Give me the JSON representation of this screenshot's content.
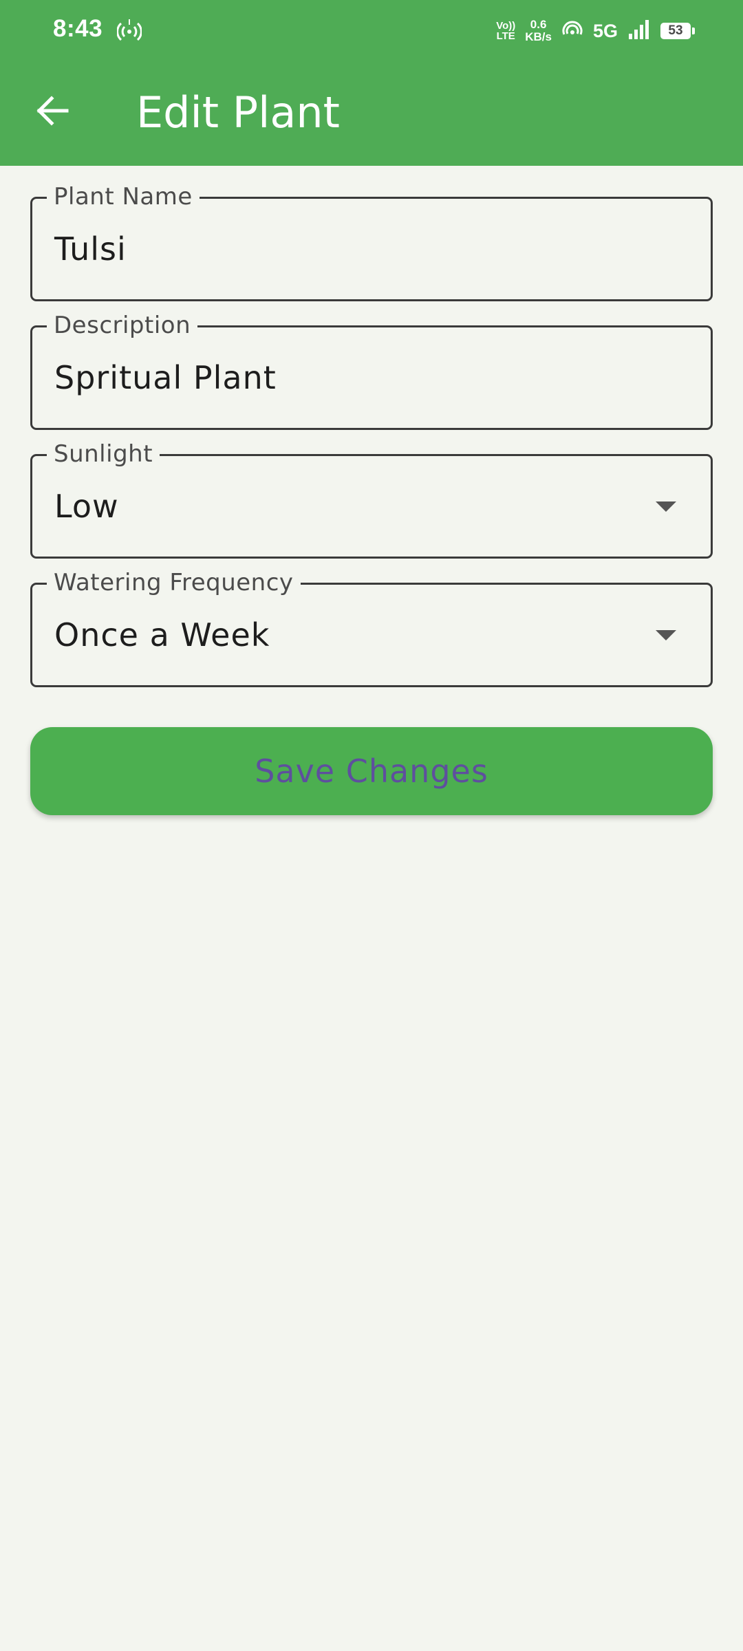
{
  "status_bar": {
    "time": "8:43",
    "volte_top": "Vo))",
    "volte_bottom": "LTE",
    "speed_value": "0.6",
    "speed_unit": "KB/s",
    "network": "5G",
    "battery": "53"
  },
  "app_bar": {
    "title": "Edit Plant",
    "background": "#4fac55"
  },
  "form": {
    "plant_name": {
      "label": "Plant Name",
      "value": "Tulsi"
    },
    "description": {
      "label": "Description",
      "value": "Spritual Plant"
    },
    "sunlight": {
      "label": "Sunlight",
      "value": "Low"
    },
    "watering": {
      "label": "Watering Frequency",
      "value": "Once a Week"
    }
  },
  "actions": {
    "save_label": "Save Changes",
    "save_color": "#4caf50",
    "save_text_color": "#5e4f9e"
  }
}
